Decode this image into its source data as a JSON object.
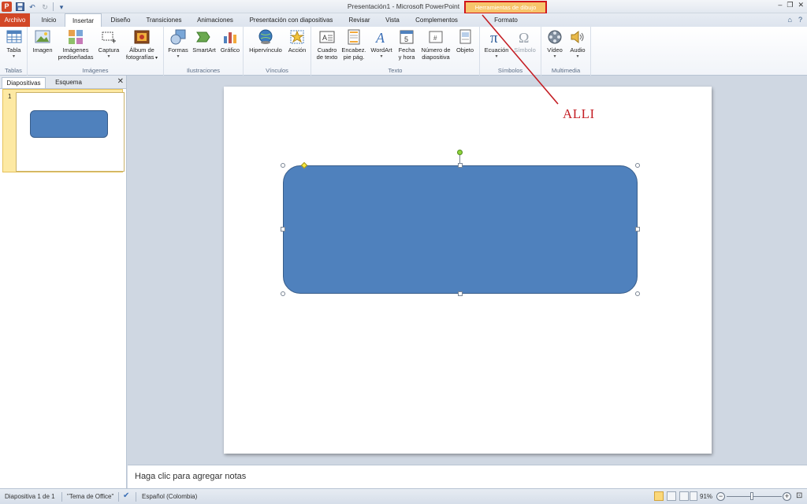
{
  "window": {
    "title": "Presentación1  -  Microsoft PowerPoint",
    "contextual_tab": "Herramientas de dibujo",
    "app_icon": "P"
  },
  "tabs": {
    "file": "Archivo",
    "items": [
      "Inicio",
      "Insertar",
      "Diseño",
      "Transiciones",
      "Animaciones",
      "Presentación con diapositivas",
      "Revisar",
      "Vista",
      "Complementos",
      "Formato"
    ],
    "active": "Insertar"
  },
  "ribbon": {
    "groups": {
      "tablas": "Tablas",
      "imagenes": "Imágenes",
      "ilustraciones": "Ilustraciones",
      "vinculos": "Vínculos",
      "texto": "Texto",
      "simbolos": "Símbolos",
      "multimedia": "Multimedia"
    },
    "buttons": {
      "tabla": "Tabla",
      "imagen": "Imagen",
      "imagenes_prediseñadas_1": "Imágenes",
      "imagenes_prediseñadas_2": "prediseñadas",
      "captura": "Captura",
      "album_1": "Álbum de",
      "album_2": "fotografías",
      "formas": "Formas",
      "smartart": "SmartArt",
      "grafico": "Gráfico",
      "hipervinculo": "Hipervínculo",
      "accion": "Acción",
      "cuadro_1": "Cuadro",
      "cuadro_2": "de texto",
      "encabez_1": "Encabez.",
      "encabez_2": "pie pág.",
      "wordart": "WordArt",
      "fecha_1": "Fecha",
      "fecha_2": "y hora",
      "numero_1": "Número de",
      "numero_2": "diapositiva",
      "objeto": "Objeto",
      "ecuacion": "Ecuación",
      "simbolo": "Símbolo",
      "video": "Vídeo",
      "audio": "Audio"
    }
  },
  "left_panel": {
    "tabs": [
      "Diapositivas",
      "Esquema"
    ],
    "active_tab": "Diapositivas",
    "slide_number": "1"
  },
  "annotation": {
    "text": "ALLI",
    "color": "#c41e24"
  },
  "slide": {
    "shape_color": "#4f81bd",
    "shape_border": "#385d8a"
  },
  "notes": {
    "placeholder": "Haga clic para agregar notas"
  },
  "statusbar": {
    "slide_info": "Diapositiva 1 de 1",
    "theme": "\"Tema de Office\"",
    "language": "Español (Colombia)",
    "zoom": "91%"
  }
}
